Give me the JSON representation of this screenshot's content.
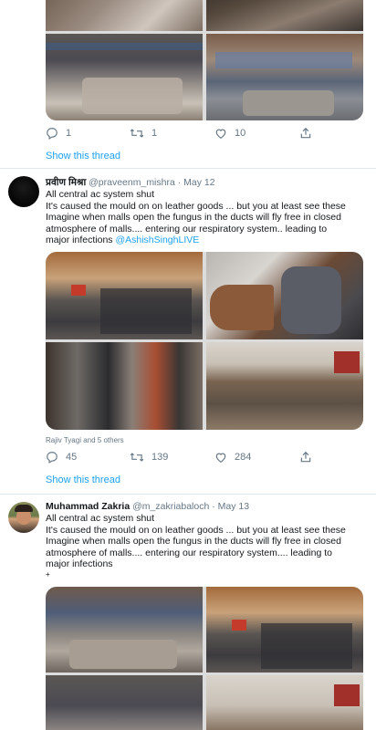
{
  "tweet1": {
    "actions": {
      "replies": "1",
      "retweets": "1",
      "likes": "10"
    },
    "show_thread": "Show this thread"
  },
  "tweet2": {
    "name": "प्रवीण मिश्रा",
    "handle": "@praveenm_mishra",
    "sep": " · ",
    "date": "May 12",
    "lines": [
      "All central ac system shut",
      "It's caused the mould on on leather goods ... but you at least see these",
      "Imagine when malls open the fungus in the ducts will fly free in closed",
      "atmosphere of malls.... entering our respiratory system.. leading to",
      "major infections"
    ],
    "mention": "@AshishSinghLIVE",
    "liked_by": "Rajiv Tyagi and 5 others",
    "actions": {
      "replies": "45",
      "retweets": "139",
      "likes": "284"
    },
    "show_thread": "Show this thread"
  },
  "tweet3": {
    "name": "Muhammad Zakria",
    "handle": "@m_zakriabaloch",
    "sep": " · ",
    "date": "May 13",
    "lines": [
      "All central ac system shut",
      "It's caused the mould on on leather goods ... but you at least see these",
      "Imagine when malls open the fungus in the ducts will fly free in closed",
      "atmosphere of malls.... entering our respiratory system.... leading to",
      "major infections",
      "+"
    ]
  },
  "icons": [
    "reply-icon",
    "retweet-icon",
    "like-icon",
    "share-icon"
  ],
  "colors": {
    "link": "#1da1f2",
    "muted": "#657786",
    "divider": "#e1e8ed"
  }
}
